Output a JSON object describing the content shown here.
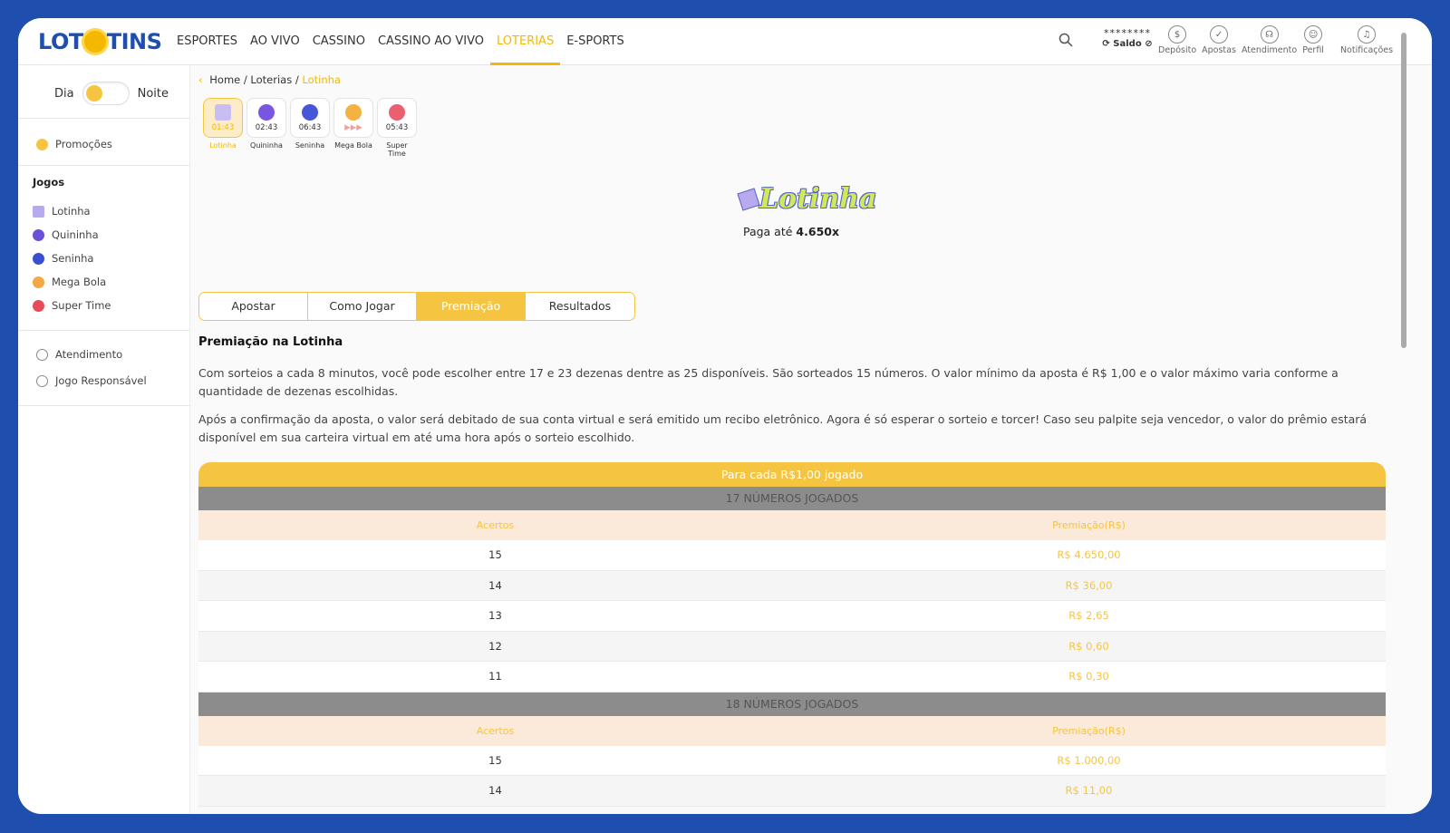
{
  "header": {
    "logo": "LOTTINS",
    "logo_left": "LOT",
    "logo_right": "TINS",
    "nav": [
      "ESPORTES",
      "AO VIVO",
      "CASSINO",
      "CASSINO AO VIVO",
      "LOTERIAS",
      "E-SPORTS"
    ],
    "active_nav": "LOTERIAS",
    "balance_mask": "********",
    "balance_label": "Saldo",
    "icons": [
      {
        "name": "deposito-icon",
        "label": "Depósito"
      },
      {
        "name": "apostas-icon",
        "label": "Apostas"
      },
      {
        "name": "atendimento-icon",
        "label": "Atendimento"
      },
      {
        "name": "perfil-icon",
        "label": "Perfil"
      },
      {
        "name": "notificacoes-icon",
        "label": "Notificações"
      }
    ]
  },
  "sidebar": {
    "day_label": "Dia",
    "night_label": "Noite",
    "promo": "Promoções",
    "games_heading": "Jogos",
    "games": [
      "Lotinha",
      "Quininha",
      "Seninha",
      "Mega Bola",
      "Super Time"
    ],
    "support": "Atendimento",
    "responsible": "Jogo Responsável"
  },
  "breadcrumb": {
    "home": "Home",
    "sep": "/",
    "loterias": "Loterias",
    "current": "Lotinha"
  },
  "game_tiles": [
    {
      "name": "Lotinha",
      "time": "01:43",
      "active": true
    },
    {
      "name": "Quininha",
      "time": "02:43"
    },
    {
      "name": "Seninha",
      "time": "06:43"
    },
    {
      "name": "Mega Bola",
      "time": "▶▶▶"
    },
    {
      "name": "Super Time",
      "time": "05:43"
    }
  ],
  "game_logo": "Lotinha",
  "payout_prefix": "Paga até",
  "payout_value": "4.650x",
  "tabs": [
    "Apostar",
    "Como Jogar",
    "Premiação",
    "Resultados"
  ],
  "active_tab": "Premiação",
  "section_title": "Premiação na Lotinha",
  "paragraphs": [
    "Com sorteios a cada 8 minutos, você pode escolher entre 17 e 23 dezenas dentre as 25 disponíveis. São sorteados 15 números. O valor mínimo da aposta é R$ 1,00 e o valor máximo varia conforme a quantidade de dezenas escolhidas.",
    "Após a confirmação da aposta, o valor será debitado de sua conta virtual e será emitido um recibo eletrônico. Agora é só esperar o sorteio e torcer! Caso seu palpite seja vencedor, o valor do prêmio estará disponível em sua carteira virtual em até uma hora após o sorteio escolhido."
  ],
  "table": {
    "top": "Para cada R$1,00 jogado",
    "col_hits": "Acertos",
    "col_prize": "Premiação(R$)",
    "groups": [
      {
        "title": "17 NÚMEROS JOGADOS",
        "rows": [
          [
            "15",
            "R$ 4.650,00"
          ],
          [
            "14",
            "R$ 36,00"
          ],
          [
            "13",
            "R$ 2,65"
          ],
          [
            "12",
            "R$ 0,60"
          ],
          [
            "11",
            "R$ 0,30"
          ]
        ]
      },
      {
        "title": "18 NÚMEROS JOGADOS",
        "rows": [
          [
            "15",
            "R$ 1.000,00"
          ],
          [
            "14",
            "R$ 11,00"
          ]
        ]
      }
    ]
  },
  "colors": {
    "brand_blue": "#1e4fae",
    "accent_yellow": "#f5c542"
  }
}
